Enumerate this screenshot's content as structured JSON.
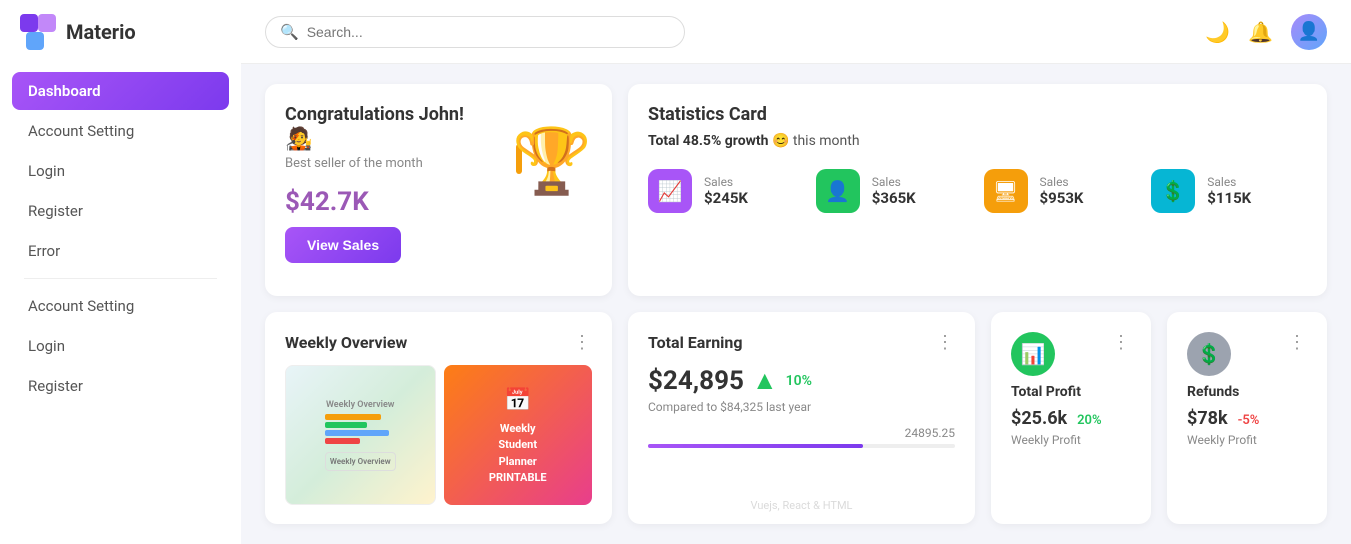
{
  "app": {
    "name": "Materio"
  },
  "sidebar": {
    "nav_items": [
      {
        "id": "dashboard",
        "label": "Dashboard",
        "active": true
      },
      {
        "id": "account-setting-1",
        "label": "Account Setting",
        "active": false
      },
      {
        "id": "login-1",
        "label": "Login",
        "active": false
      },
      {
        "id": "register-1",
        "label": "Register",
        "active": false
      },
      {
        "id": "error",
        "label": "Error",
        "active": false
      },
      {
        "id": "account-setting-2",
        "label": "Account Setting",
        "active": false
      },
      {
        "id": "login-2",
        "label": "Login",
        "active": false
      },
      {
        "id": "register-2",
        "label": "Register",
        "active": false
      }
    ]
  },
  "header": {
    "search_placeholder": "Search..."
  },
  "congrats_card": {
    "title": "Congratulations John!",
    "subtitle": "Best seller of the month",
    "amount": "$42.7K",
    "button_label": "View Sales",
    "trophy_emoji": "🏆"
  },
  "stats_card": {
    "title": "Statistics Card",
    "growth_text": "Total 48.5% growth",
    "growth_emoji": "😊",
    "this_month": "this month",
    "items": [
      {
        "id": "sales-1",
        "label": "Sales",
        "value": "$245K",
        "color": "#a855f7",
        "icon": "📈"
      },
      {
        "id": "sales-2",
        "label": "Sales",
        "value": "$365K",
        "color": "#22c55e",
        "icon": "👤"
      },
      {
        "id": "sales-3",
        "label": "Sales",
        "value": "$953K",
        "color": "#f59e0b",
        "icon": "🖥"
      },
      {
        "id": "sales-4",
        "label": "Sales",
        "value": "$115K",
        "color": "#06b6d4",
        "icon": "💲"
      }
    ]
  },
  "weekly_overview": {
    "title": "Weekly Overview",
    "img1_text": "Weekly\nOverview",
    "img2_text": "Weekly\nStudent\nPlanner\nPrintable"
  },
  "total_earning": {
    "title": "Total Earning",
    "amount": "$24,895",
    "percent": "10%",
    "compare_text": "Compared to $84,325 last year",
    "bar_value": "24895.25",
    "watermark_line1": "Vuejs, React & HTML"
  },
  "total_profit": {
    "title": "Total Profit",
    "amount": "$25.6k",
    "percent": "20%",
    "label": "Weekly Profit",
    "icon": "📊"
  },
  "refunds": {
    "title": "Refunds",
    "amount": "$78k",
    "percent": "-5%",
    "label": "Weekly Profit",
    "icon": "💲"
  }
}
